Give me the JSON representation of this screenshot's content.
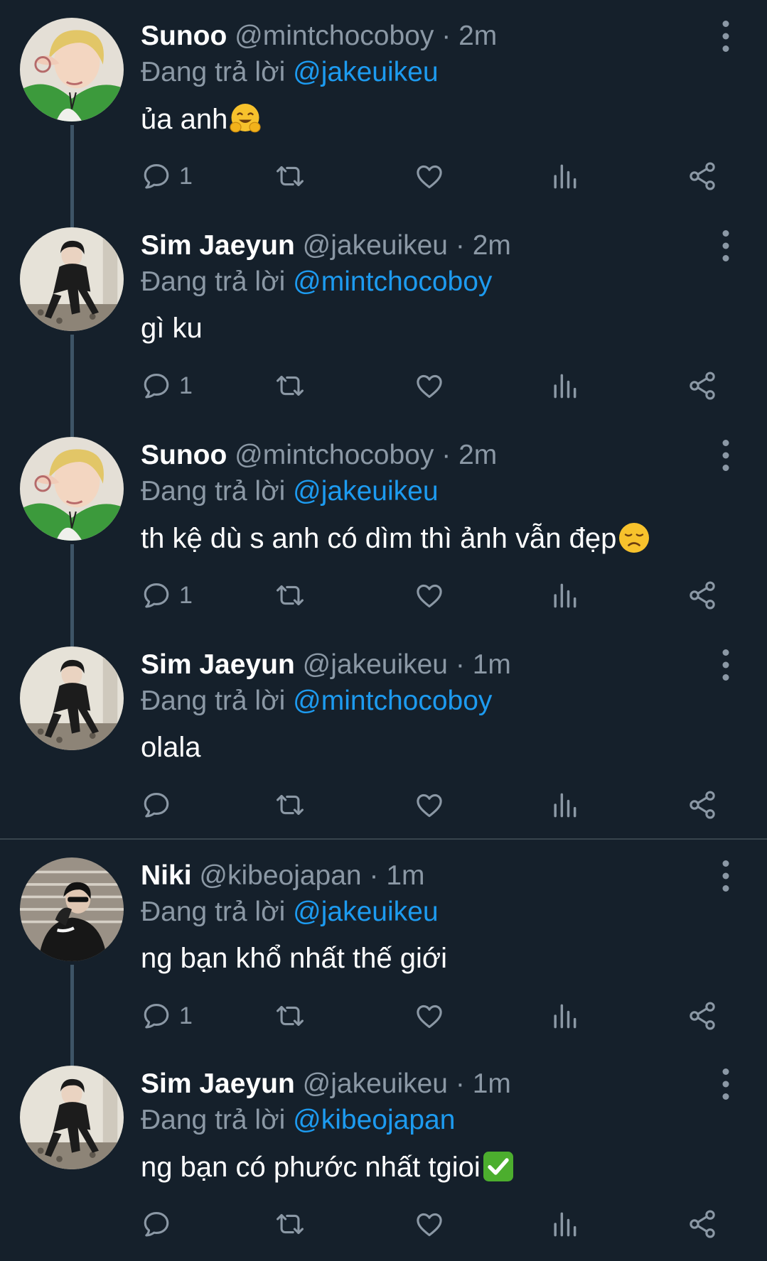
{
  "tweets": [
    {
      "name": "Sunoo",
      "handle": "@mintchocoboy",
      "dot": "·",
      "time": "2m",
      "reply_prefix": "Đang trả lời",
      "reply_to": "@jakeuikeu",
      "text": "ủa anh",
      "emoji": "hugging-face-emoji",
      "reply_count": "1",
      "avatar": "sunoo-avatar"
    },
    {
      "name": "Sim Jaeyun",
      "handle": "@jakeuikeu",
      "dot": "·",
      "time": "2m",
      "reply_prefix": "Đang trả lời",
      "reply_to": "@mintchocoboy",
      "text": "gì ku",
      "reply_count": "1",
      "avatar": "jaeyun-avatar"
    },
    {
      "name": "Sunoo",
      "handle": "@mintchocoboy",
      "dot": "·",
      "time": "2m",
      "reply_prefix": "Đang trả lời",
      "reply_to": "@jakeuikeu",
      "text": "th kệ dù s anh có dìm thì ảnh vẫn đẹp",
      "emoji": "disappointed-face-emoji",
      "reply_count": "1",
      "avatar": "sunoo-avatar"
    },
    {
      "name": "Sim Jaeyun",
      "handle": "@jakeuikeu",
      "dot": "·",
      "time": "1m",
      "reply_prefix": "Đang trả lời",
      "reply_to": "@mintchocoboy",
      "text": "olala",
      "reply_count": "",
      "avatar": "jaeyun-avatar"
    },
    {
      "name": "Niki",
      "handle": "@kibeojapan",
      "dot": "·",
      "time": "1m",
      "reply_prefix": "Đang trả lời",
      "reply_to": "@jakeuikeu",
      "text": "ng bạn khổ nhất thế giới",
      "reply_count": "1",
      "avatar": "niki-avatar"
    },
    {
      "name": "Sim Jaeyun",
      "handle": "@jakeuikeu",
      "dot": "·",
      "time": "1m",
      "reply_prefix": "Đang trả lời",
      "reply_to": "@kibeojapan",
      "text": "ng bạn có phước nhất tgioi",
      "emoji": "check-mark-emoji",
      "reply_count": "",
      "avatar": "jaeyun-avatar"
    }
  ],
  "colors": {
    "background": "#15202b",
    "secondary_text": "#8b98a5",
    "mention": "#1d9bf0",
    "thread_line": "#3d5466",
    "divider": "#38444d"
  },
  "icons": {
    "reply": "reply-icon",
    "retweet": "retweet-icon",
    "like": "like-icon",
    "views": "views-icon",
    "share": "share-icon",
    "more": "more-options-icon"
  }
}
